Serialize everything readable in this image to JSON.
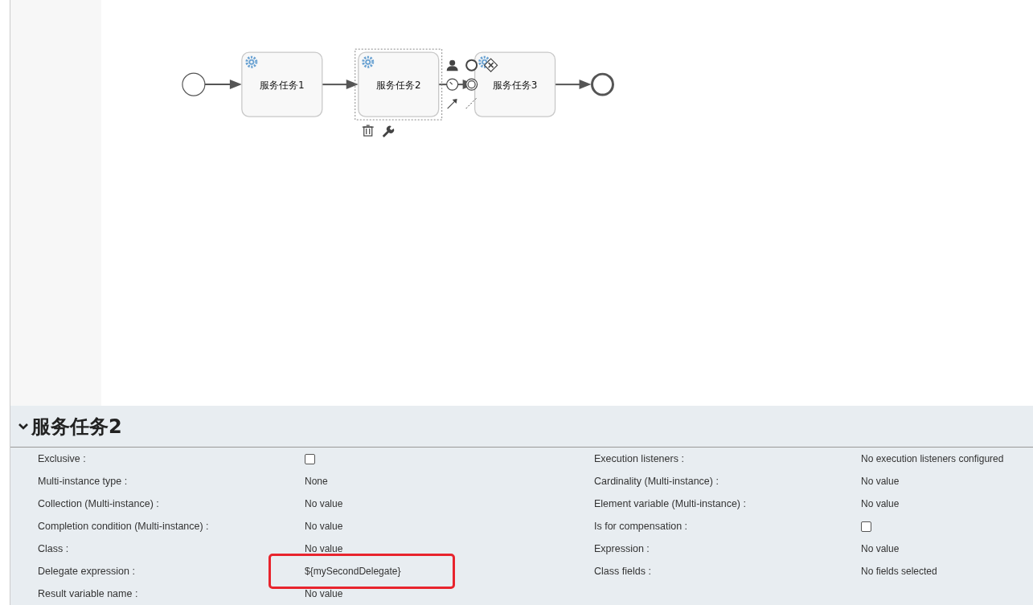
{
  "diagram": {
    "nodes": [
      {
        "kind": "start"
      },
      {
        "kind": "task",
        "label": "服务任务1",
        "selected": false
      },
      {
        "kind": "task",
        "label": "服务任务2",
        "selected": true
      },
      {
        "kind": "task",
        "label": "服务任务3",
        "selected": false
      },
      {
        "kind": "end"
      }
    ]
  },
  "properties": {
    "title": "服务任务2",
    "expanded": true,
    "left": [
      {
        "label": "Exclusive :",
        "kind": "checkbox",
        "checked": false
      },
      {
        "label": "Multi-instance type :",
        "kind": "text",
        "value": "None"
      },
      {
        "label": "Collection (Multi-instance) :",
        "kind": "text",
        "value": "No value"
      },
      {
        "label": "Completion condition (Multi-instance) :",
        "kind": "text",
        "value": "No value"
      },
      {
        "label": "Class :",
        "kind": "text",
        "value": "No value"
      },
      {
        "label": "Delegate expression :",
        "kind": "text",
        "value": "${mySecondDelegate}",
        "highlighted": true
      },
      {
        "label": "Result variable name :",
        "kind": "text",
        "value": "No value"
      }
    ],
    "right": [
      {
        "label": "Execution listeners :",
        "kind": "text",
        "value": "No execution listeners configured"
      },
      {
        "label": "Cardinality (Multi-instance) :",
        "kind": "text",
        "value": "No value"
      },
      {
        "label": "Element variable (Multi-instance) :",
        "kind": "text",
        "value": "No value"
      },
      {
        "label": "Is for compensation :",
        "kind": "checkbox",
        "checked": false
      },
      {
        "label": "Expression :",
        "kind": "text",
        "value": "No value"
      },
      {
        "label": "Class fields :",
        "kind": "text",
        "value": "No fields selected"
      }
    ]
  }
}
